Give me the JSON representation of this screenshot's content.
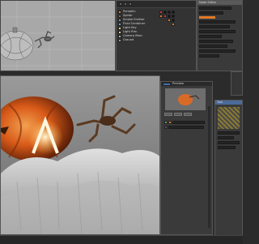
{
  "node_editor": {
    "title": "Node Editor"
  },
  "tool_window": {
    "title": "Tool"
  },
  "outliner": {
    "items": [
      {
        "label": "Pumpkin"
      },
      {
        "label": "Spider"
      },
      {
        "label": "Smoke Emitter"
      },
      {
        "label": "Fluid Container"
      },
      {
        "label": "Light Key"
      },
      {
        "label": "Light Rim"
      },
      {
        "label": "Camera Main"
      },
      {
        "label": "Ground"
      }
    ]
  },
  "render_preview": {
    "label": "Preview"
  },
  "colors": {
    "viewport_bg": "#b8b8b8",
    "render_bg": "#8a8a8a",
    "panel_bg": "#3a3a3a",
    "accent_orange": "#e07b2a"
  }
}
